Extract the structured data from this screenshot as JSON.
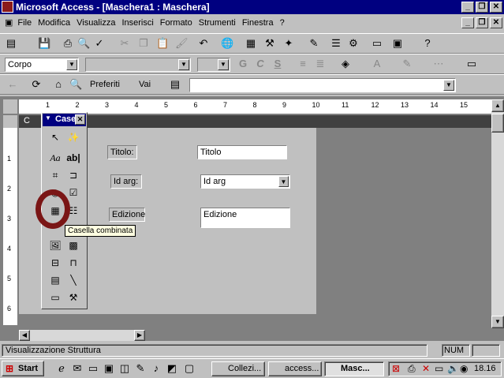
{
  "window": {
    "title": "Microsoft Access - [Maschera1 : Maschera]",
    "min": "_",
    "restore": "❐",
    "close": "✕"
  },
  "menu": [
    "File",
    "Modifica",
    "Visualizza",
    "Inserisci",
    "Formato",
    "Strumenti",
    "Finestra",
    "?"
  ],
  "format_toolbar": {
    "object_combo": "Corpo",
    "font_combo": "",
    "size_combo": ""
  },
  "web_toolbar": {
    "favorites_label": "Preferiti",
    "go_label": "Vai",
    "address_value": ""
  },
  "section": {
    "header_label": "C"
  },
  "toolbox": {
    "title": "Case"
  },
  "ruler": {
    "h_ticks": [
      "1",
      "2",
      "3",
      "4",
      "5",
      "6",
      "7",
      "8",
      "9",
      "10",
      "11",
      "12",
      "13",
      "14",
      "15"
    ],
    "v_ticks": [
      "1",
      "2",
      "3",
      "4",
      "5",
      "6"
    ]
  },
  "form": {
    "fields": [
      {
        "label": "Titolo:",
        "value": "Titolo"
      },
      {
        "label": "Id arg:",
        "value": "Id arg"
      },
      {
        "label": "Edizione",
        "value": "Edizione"
      }
    ]
  },
  "tooltip": "Casella combinata",
  "status": {
    "text": "Visualizzazione Struttura",
    "num": "NUM"
  },
  "taskbar": {
    "start": "Start",
    "tasks": [
      "Collezi...",
      "access...",
      "Masc..."
    ],
    "clock": "18.16"
  },
  "colors": {
    "title_bg": "#000080",
    "circle": "#7a1515",
    "tooltip_bg": "#ffffe1"
  }
}
